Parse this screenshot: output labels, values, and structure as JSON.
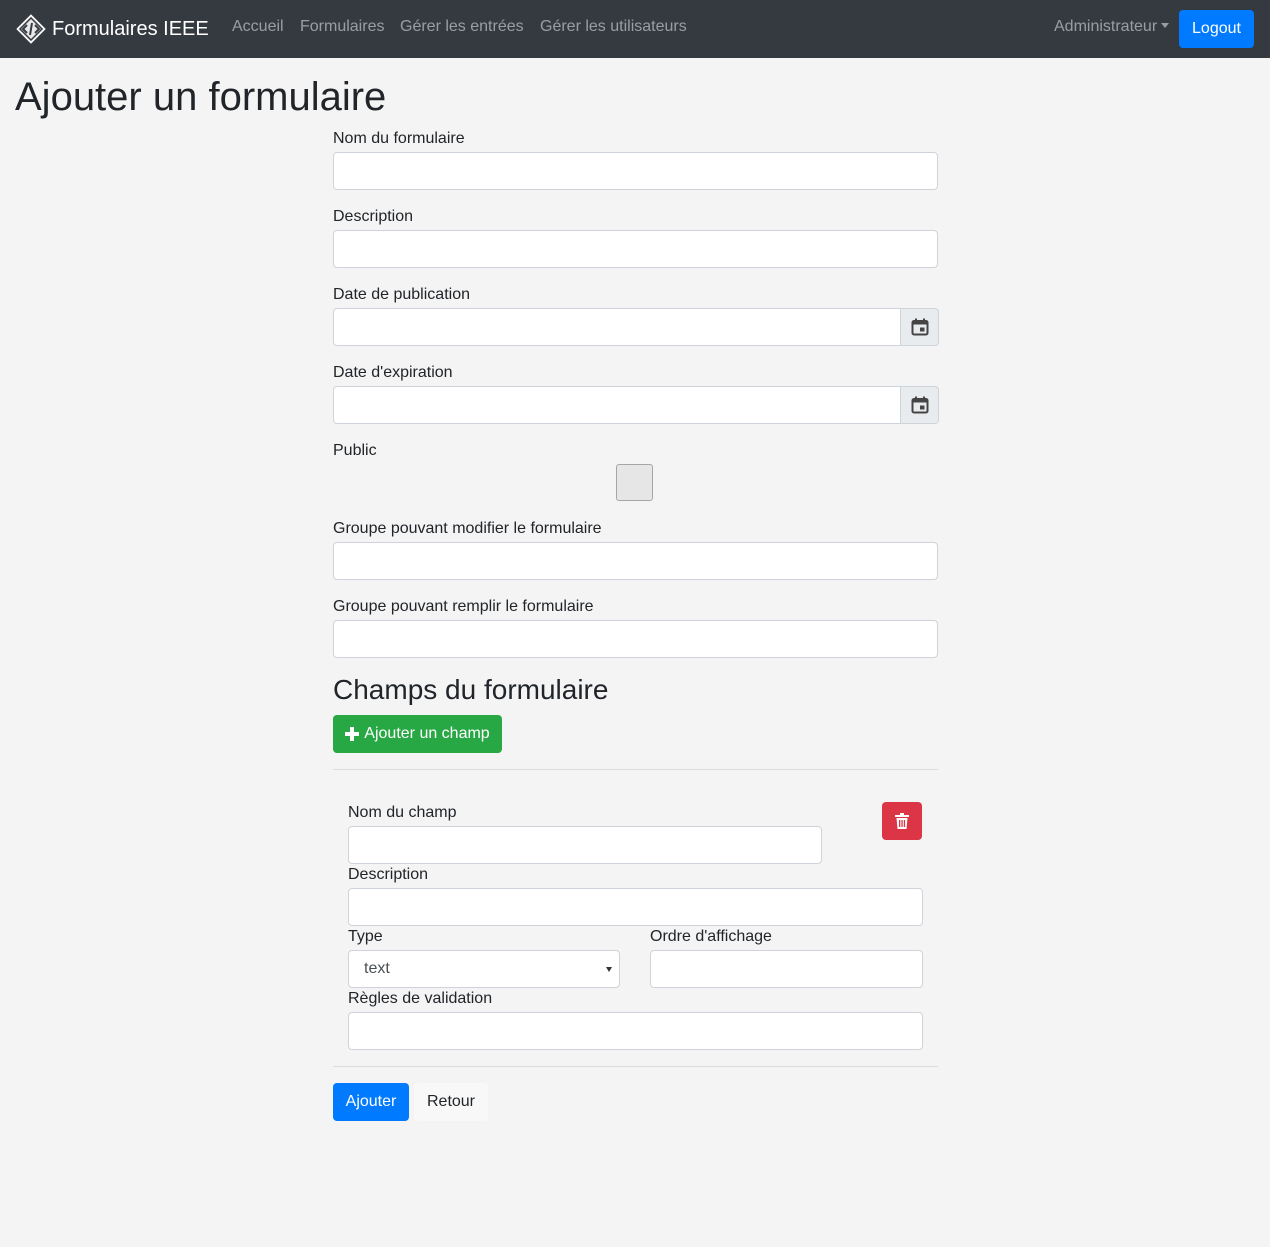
{
  "navbar": {
    "brand": "Formulaires IEEE",
    "links": [
      "Accueil",
      "Formulaires",
      "Gérer les entrées",
      "Gérer les utilisateurs"
    ],
    "user_menu": "Administrateur",
    "logout": "Logout"
  },
  "page": {
    "title": "Ajouter un formulaire"
  },
  "form": {
    "name_label": "Nom du formulaire",
    "name_value": "",
    "description_label": "Description",
    "description_value": "",
    "publish_date_label": "Date de publication",
    "publish_date_value": "",
    "expiry_date_label": "Date d'expiration",
    "expiry_date_value": "",
    "public_label": "Public",
    "public_checked": false,
    "edit_group_label": "Groupe pouvant modifier le formulaire",
    "edit_group_value": "",
    "fill_group_label": "Groupe pouvant remplir le formulaire",
    "fill_group_value": ""
  },
  "fields_section": {
    "title": "Champs du formulaire",
    "add_button": "Ajouter un champ",
    "field": {
      "name_label": "Nom du champ",
      "name_value": "",
      "description_label": "Description",
      "description_value": "",
      "type_label": "Type",
      "type_value": "text",
      "order_label": "Ordre d'affichage",
      "order_value": "",
      "validation_label": "Règles de validation",
      "validation_value": ""
    }
  },
  "actions": {
    "submit": "Ajouter",
    "back": "Retour"
  },
  "colors": {
    "navbar": "#343a40",
    "primary": "#007bff",
    "success": "#28a745",
    "danger": "#dc3545",
    "background": "#f4f4f4"
  },
  "icons": [
    "brand-logo-icon",
    "calendar-icon",
    "plus-icon",
    "trash-icon",
    "chevron-down-icon"
  ]
}
